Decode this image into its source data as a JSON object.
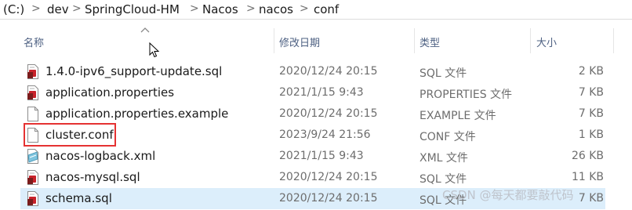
{
  "breadcrumb": {
    "items": [
      "(C:)",
      "dev",
      "SpringCloud-HM",
      "Nacos",
      "nacos",
      "conf"
    ],
    "separator": ">"
  },
  "columns": {
    "name": "名称",
    "modified": "修改日期",
    "type": "类型",
    "size": "大小"
  },
  "files": [
    {
      "name": "1.4.0-ipv6_support-update.sql",
      "modified": "2020/12/24 20:15",
      "type": "SQL 文件",
      "size": "2 KB",
      "icon": "sql-file-icon"
    },
    {
      "name": "application.properties",
      "modified": "2021/1/15 9:43",
      "type": "PROPERTIES 文件",
      "size": "7 KB",
      "icon": "properties-file-icon"
    },
    {
      "name": "application.properties.example",
      "modified": "2020/12/24 20:15",
      "type": "EXAMPLE 文件",
      "size": "7 KB",
      "icon": "blank-file-icon"
    },
    {
      "name": "cluster.conf",
      "modified": "2023/9/24 21:56",
      "type": "CONF 文件",
      "size": "1 KB",
      "icon": "blank-file-icon"
    },
    {
      "name": "nacos-logback.xml",
      "modified": "2021/1/15 9:43",
      "type": "XML 文件",
      "size": "26 KB",
      "icon": "xml-file-icon"
    },
    {
      "name": "nacos-mysql.sql",
      "modified": "2020/12/24 20:15",
      "type": "SQL 文件",
      "size": "11 KB",
      "icon": "sql-file-icon"
    },
    {
      "name": "schema.sql",
      "modified": "2020/12/24 20:15",
      "type": "SQL 文件",
      "size": "7 KB",
      "icon": "sql-file-icon"
    }
  ],
  "watermark": "CSDN @每天都要敲代码",
  "colors": {
    "selection": "#dceefb",
    "highlight_border": "#e53232",
    "header_text": "#4d6082"
  }
}
